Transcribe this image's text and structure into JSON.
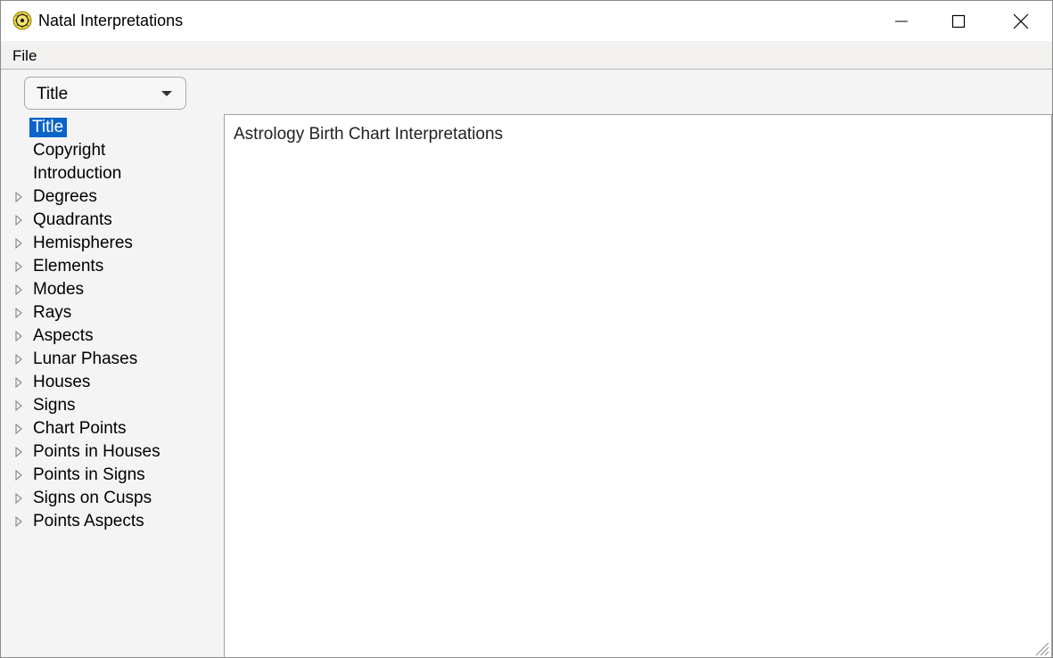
{
  "window": {
    "title": "Natal Interpretations"
  },
  "menu": {
    "file_label": "File"
  },
  "toolbar": {
    "combo_value": "Title"
  },
  "tree": {
    "items": [
      {
        "label": "Title",
        "expandable": false,
        "selected": true
      },
      {
        "label": "Copyright",
        "expandable": false,
        "selected": false
      },
      {
        "label": "Introduction",
        "expandable": false,
        "selected": false
      },
      {
        "label": "Degrees",
        "expandable": true,
        "selected": false
      },
      {
        "label": "Quadrants",
        "expandable": true,
        "selected": false
      },
      {
        "label": "Hemispheres",
        "expandable": true,
        "selected": false
      },
      {
        "label": "Elements",
        "expandable": true,
        "selected": false
      },
      {
        "label": "Modes",
        "expandable": true,
        "selected": false
      },
      {
        "label": "Rays",
        "expandable": true,
        "selected": false
      },
      {
        "label": "Aspects",
        "expandable": true,
        "selected": false
      },
      {
        "label": "Lunar Phases",
        "expandable": true,
        "selected": false
      },
      {
        "label": "Houses",
        "expandable": true,
        "selected": false
      },
      {
        "label": "Signs",
        "expandable": true,
        "selected": false
      },
      {
        "label": "Chart Points",
        "expandable": true,
        "selected": false
      },
      {
        "label": "Points in Houses",
        "expandable": true,
        "selected": false
      },
      {
        "label": "Points in Signs",
        "expandable": true,
        "selected": false
      },
      {
        "label": "Signs on Cusps",
        "expandable": true,
        "selected": false
      },
      {
        "label": "Points Aspects",
        "expandable": true,
        "selected": false
      }
    ]
  },
  "content": {
    "text": "Astrology Birth Chart Interpretations"
  },
  "colors": {
    "selection": "#0a64c8",
    "icon_ring": "#d4b400"
  }
}
